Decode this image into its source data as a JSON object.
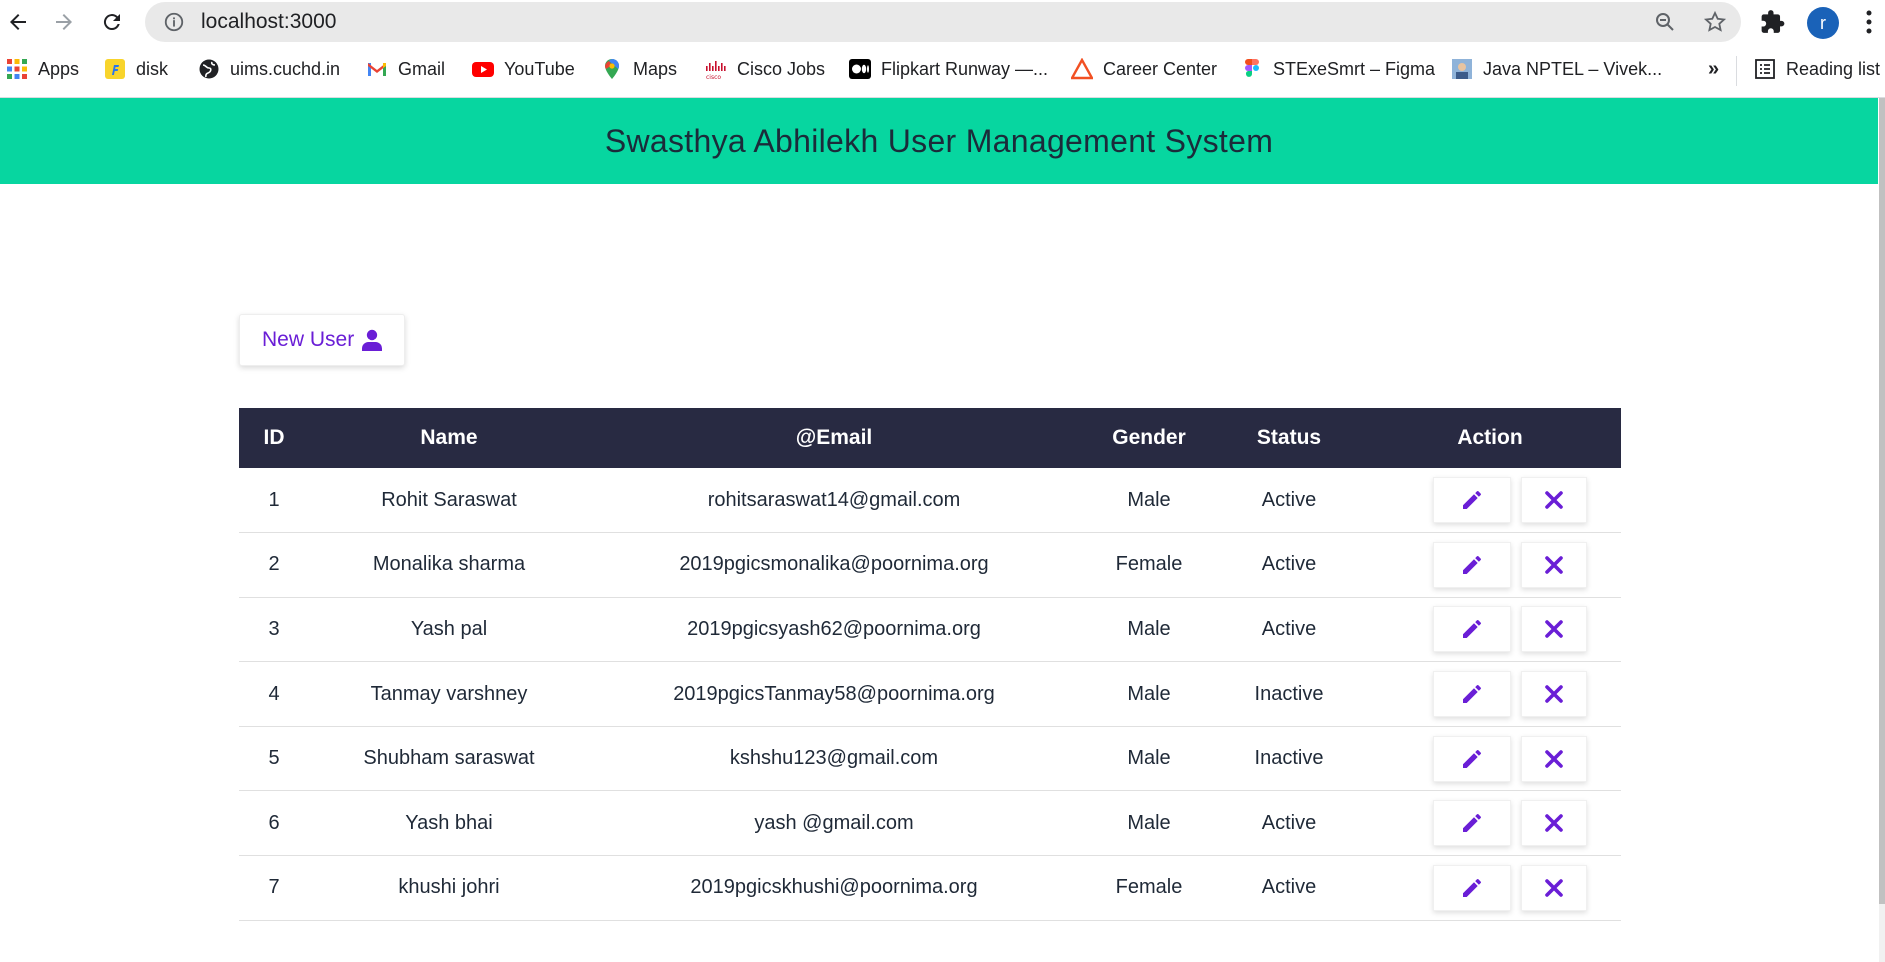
{
  "browser": {
    "url": "localhost:3000",
    "profile_initial": "r",
    "bookmarks": [
      {
        "label": "Apps",
        "icon": "apps-grid-icon"
      },
      {
        "label": "disk",
        "icon": "flipkart-icon"
      },
      {
        "label": "uims.cuchd.in",
        "icon": "globe-icon"
      },
      {
        "label": "Gmail",
        "icon": "gmail-icon"
      },
      {
        "label": "YouTube",
        "icon": "youtube-icon"
      },
      {
        "label": "Maps",
        "icon": "maps-icon"
      },
      {
        "label": "Cisco Jobs",
        "icon": "cisco-icon"
      },
      {
        "label": "Flipkart Runway —...",
        "icon": "medium-icon"
      },
      {
        "label": "Career Center",
        "icon": "career-icon"
      },
      {
        "label": "STExeSmrt – Figma",
        "icon": "figma-icon"
      },
      {
        "label": "Java NPTEL – Vivek...",
        "icon": "nptel-icon"
      }
    ],
    "more_label": "»",
    "reading_list_label": "Reading list"
  },
  "header": {
    "title": "Swasthya Abhilekh User Management System",
    "bg_color": "#07d6a0"
  },
  "new_user_button": {
    "label": "New User",
    "icon": "user-icon"
  },
  "table": {
    "columns": [
      "ID",
      "Name",
      "@Email",
      "Gender",
      "Status",
      "Action"
    ],
    "rows": [
      {
        "id": "1",
        "name": "Rohit Saraswat",
        "email": "rohitsaraswat14@gmail.com",
        "gender": "Male",
        "status": "Active"
      },
      {
        "id": "2",
        "name": "Monalika sharma",
        "email": "2019pgicsmonalika@poornima.org",
        "gender": "Female",
        "status": "Active"
      },
      {
        "id": "3",
        "name": "Yash pal",
        "email": "2019pgicsyash62@poornima.org",
        "gender": "Male",
        "status": "Active"
      },
      {
        "id": "4",
        "name": "Tanmay varshney",
        "email": "2019pgicsTanmay58@poornima.org",
        "gender": "Male",
        "status": "Inactive"
      },
      {
        "id": "5",
        "name": "Shubham saraswat",
        "email": "kshshu123@gmail.com",
        "gender": "Male",
        "status": "Inactive"
      },
      {
        "id": "6",
        "name": "Yash bhai",
        "email": "yash @gmail.com",
        "gender": "Male",
        "status": "Active"
      },
      {
        "id": "7",
        "name": "khushi johri",
        "email": "2019pgicskhushi@poornima.org",
        "gender": "Female",
        "status": "Active"
      }
    ],
    "header_bg": "#282a42",
    "accent_color": "#6a1ed6",
    "row_actions": [
      "pencil-icon",
      "close-icon"
    ]
  }
}
